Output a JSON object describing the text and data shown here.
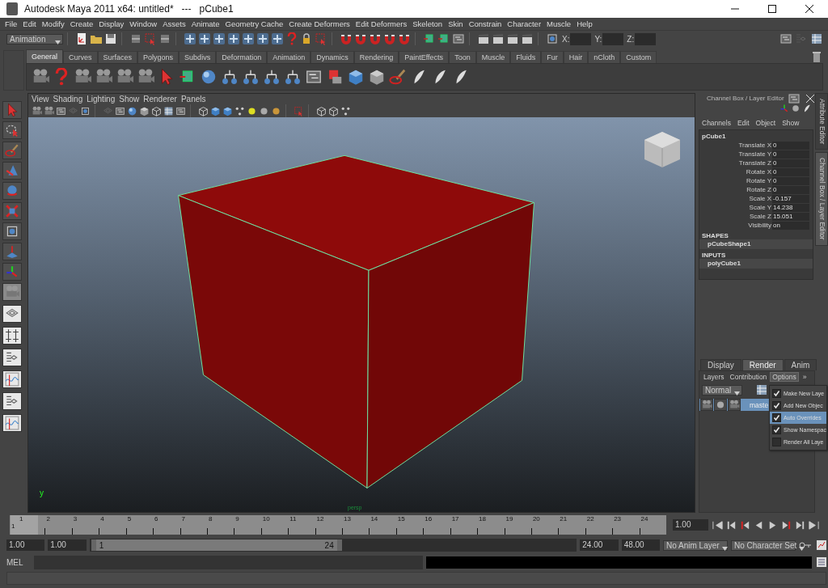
{
  "window": {
    "title": "Autodesk Maya 2011 x64: untitled*   ---   pCube1"
  },
  "menu_bar": [
    "File",
    "Edit",
    "Modify",
    "Create",
    "Display",
    "Window",
    "Assets",
    "Animate",
    "Geometry Cache",
    "Create Deformers",
    "Edit Deformers",
    "Skeleton",
    "Skin",
    "Constrain",
    "Character",
    "Muscle",
    "Help"
  ],
  "status_line": {
    "menu_set": "Animation",
    "coordinates": [
      {
        "label": "X:"
      },
      {
        "label": "Y:"
      },
      {
        "label": "Z:"
      }
    ]
  },
  "shelf": {
    "tabs": [
      {
        "label": "General",
        "selected": true
      },
      {
        "label": "Curves",
        "selected": false
      },
      {
        "label": "Surfaces",
        "selected": false
      },
      {
        "label": "Polygons",
        "selected": false
      },
      {
        "label": "Subdivs",
        "selected": false
      },
      {
        "label": "Deformation",
        "selected": false
      },
      {
        "label": "Animation",
        "selected": false
      },
      {
        "label": "Dynamics",
        "selected": false
      },
      {
        "label": "Rendering",
        "selected": false
      },
      {
        "label": "PaintEffects",
        "selected": false
      },
      {
        "label": "Toon",
        "selected": false
      },
      {
        "label": "Muscle",
        "selected": false
      },
      {
        "label": "Fluids",
        "selected": false
      },
      {
        "label": "Fur",
        "selected": false
      },
      {
        "label": "Hair",
        "selected": false
      },
      {
        "label": "nCloth",
        "selected": false
      },
      {
        "label": "Custom",
        "selected": false
      }
    ]
  },
  "viewport": {
    "menus": [
      "View",
      "Shading",
      "Lighting",
      "Show",
      "Renderer",
      "Panels"
    ],
    "axis_label": "y",
    "camera": "persp"
  },
  "channel_box": {
    "title": "Channel Box / Layer Editor",
    "menus": [
      "Channels",
      "Edit",
      "Object",
      "Show"
    ],
    "object": "pCube1",
    "channels": [
      {
        "name": "Translate X",
        "value": "0"
      },
      {
        "name": "Translate Y",
        "value": "0"
      },
      {
        "name": "Translate Z",
        "value": "0"
      },
      {
        "name": "Rotate X",
        "value": "0"
      },
      {
        "name": "Rotate Y",
        "value": "0"
      },
      {
        "name": "Rotate Z",
        "value": "0"
      },
      {
        "name": "Scale X",
        "value": "-0.157"
      },
      {
        "name": "Scale Y",
        "value": "14.238"
      },
      {
        "name": "Scale Z",
        "value": "15.051"
      },
      {
        "name": "Visibility",
        "value": "on"
      }
    ],
    "sections": [
      {
        "header": "SHAPES",
        "items": [
          "pCubeShape1"
        ]
      },
      {
        "header": "INPUTS",
        "items": [
          "polyCube1"
        ]
      }
    ]
  },
  "side_tabs": [
    {
      "label": "Attribute Editor",
      "selected": false
    },
    {
      "label": "Channel Box / Layer Editor",
      "selected": true
    }
  ],
  "layer_editor": {
    "tabs": [
      {
        "label": "Display",
        "selected": false
      },
      {
        "label": "Render",
        "selected": true
      },
      {
        "label": "Anim",
        "selected": false
      }
    ],
    "menus": [
      {
        "label": "Layers",
        "selected": false
      },
      {
        "label": "Contribution",
        "selected": false
      },
      {
        "label": "Options",
        "selected": true
      }
    ],
    "more": "»",
    "blend_mode": "Normal",
    "layers": [
      {
        "name": "maste",
        "selected": true
      }
    ]
  },
  "options_menu": [
    {
      "label": "Make New Laye",
      "checked": true,
      "selected": false
    },
    {
      "label": "Add New Objec",
      "checked": true,
      "selected": false
    },
    {
      "label": "Auto Overrides",
      "checked": true,
      "selected": true
    },
    {
      "label": "Show Namespac",
      "checked": true,
      "selected": false
    },
    {
      "label": "Render All Laye",
      "checked": false,
      "selected": false
    }
  ],
  "time_slider": {
    "ticks": [
      {
        "label": "1",
        "current": true
      },
      {
        "label": "2",
        "current": false
      },
      {
        "label": "3",
        "current": false
      },
      {
        "label": "4",
        "current": false
      },
      {
        "label": "5",
        "current": false
      },
      {
        "label": "6",
        "current": false
      },
      {
        "label": "7",
        "current": false
      },
      {
        "label": "8",
        "current": false
      },
      {
        "label": "9",
        "current": false
      },
      {
        "label": "10",
        "current": false
      },
      {
        "label": "11",
        "current": false
      },
      {
        "label": "12",
        "current": false
      },
      {
        "label": "13",
        "current": false
      },
      {
        "label": "14",
        "current": false
      },
      {
        "label": "15",
        "current": false
      },
      {
        "label": "16",
        "current": false
      },
      {
        "label": "17",
        "current": false
      },
      {
        "label": "18",
        "current": false
      },
      {
        "label": "19",
        "current": false
      },
      {
        "label": "20",
        "current": false
      },
      {
        "label": "21",
        "current": false
      },
      {
        "label": "22",
        "current": false
      },
      {
        "label": "23",
        "current": false
      },
      {
        "label": "24",
        "current": false
      }
    ],
    "current_frame": "1",
    "current_time": "1.00"
  },
  "range_slider": {
    "start": "1.00",
    "playback_start": "1.00",
    "range_start": "1",
    "range_end": "24",
    "playback_end": "24.00",
    "end": "48.00",
    "anim_layer": "No Anim Layer",
    "character_set": "No Character Set"
  },
  "command_line": {
    "language": "MEL"
  }
}
